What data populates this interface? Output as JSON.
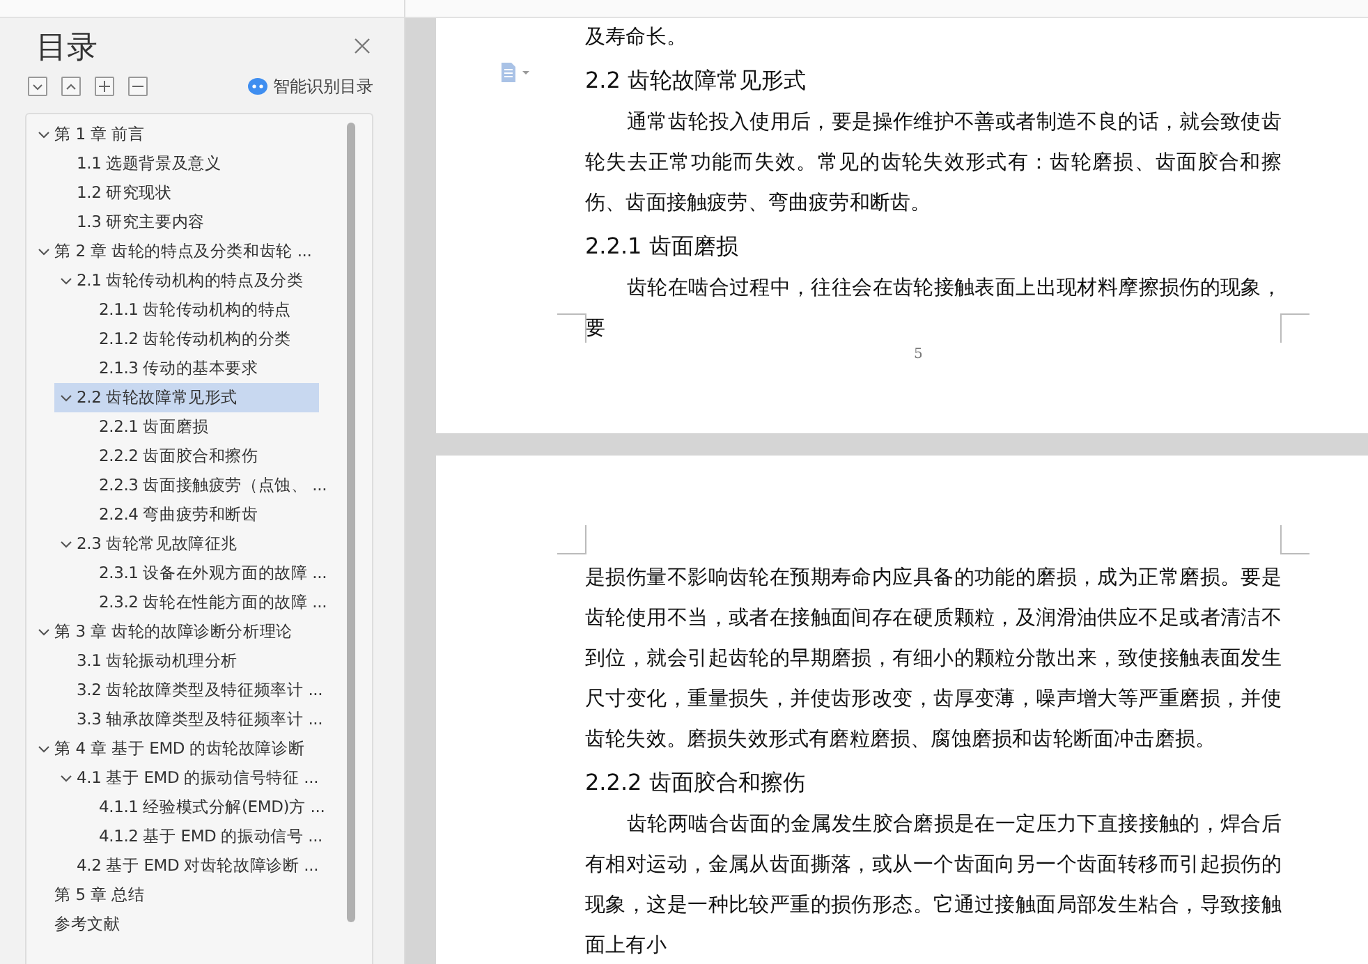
{
  "toc_panel": {
    "title": "目录",
    "smart_button": "智能识别目录",
    "items": [
      {
        "label": "第 1 章  前言",
        "selected": false,
        "expanded": true,
        "children": [
          {
            "label": "1.1 选题背景及意义",
            "selected": false
          },
          {
            "label": "1.2 研究现状",
            "selected": false
          },
          {
            "label": "1.3 研究主要内容",
            "selected": false
          }
        ]
      },
      {
        "label": "第 2 章  齿轮的特点及分类和齿轮 ...",
        "selected": false,
        "expanded": true,
        "children": [
          {
            "label": "2.1 齿轮传动机构的特点及分类",
            "selected": false,
            "expanded": true,
            "children": [
              {
                "label": "2.1.1 齿轮传动机构的特点",
                "selected": false
              },
              {
                "label": "2.1.2 齿轮传动机构的分类",
                "selected": false
              },
              {
                "label": "2.1.3 传动的基本要求",
                "selected": false
              }
            ]
          },
          {
            "label": "2.2 齿轮故障常见形式",
            "selected": true,
            "expanded": true,
            "children": [
              {
                "label": "2.2.1 齿面磨损",
                "selected": false
              },
              {
                "label": "2.2.2 齿面胶合和擦伤",
                "selected": false
              },
              {
                "label": "2.2.3 齿面接触疲劳（点蚀、 ...",
                "selected": false
              },
              {
                "label": "2.2.4 弯曲疲劳和断齿",
                "selected": false
              }
            ]
          },
          {
            "label": "2.3 齿轮常见故障征兆",
            "selected": false,
            "expanded": true,
            "children": [
              {
                "label": "2.3.1 设备在外观方面的故障 ...",
                "selected": false
              },
              {
                "label": "2.3.2 齿轮在性能方面的故障 ...",
                "selected": false
              }
            ]
          }
        ]
      },
      {
        "label": "第 3 章  齿轮的故障诊断分析理论",
        "selected": false,
        "expanded": true,
        "children": [
          {
            "label": "3.1 齿轮振动机理分析",
            "selected": false
          },
          {
            "label": "3.2 齿轮故障类型及特征频率计 ...",
            "selected": false
          },
          {
            "label": "3.3 轴承故障类型及特征频率计 ...",
            "selected": false
          }
        ]
      },
      {
        "label": "第 4 章  基于 EMD 的齿轮故障诊断",
        "selected": false,
        "expanded": true,
        "children": [
          {
            "label": "4.1 基于 EMD 的振动信号特征 ...",
            "selected": false,
            "expanded": true,
            "children": [
              {
                "label": "4.1.1 经验模式分解(EMD)方 ...",
                "selected": false
              },
              {
                "label": "4.1.2 基于 EMD 的振动信号 ...",
                "selected": false
              }
            ]
          },
          {
            "label": "4.2 基于 EMD 对齿轮故障诊断 ...",
            "selected": false
          }
        ]
      },
      {
        "label": "第 5 章  总结",
        "selected": false
      },
      {
        "label": "参考文献",
        "selected": false
      }
    ]
  },
  "pages": [
    {
      "page_number": "5",
      "blocks": [
        {
          "kind": "body",
          "text": "及寿命长。"
        },
        {
          "kind": "heading",
          "text": "2.2 齿轮故障常见形式"
        },
        {
          "kind": "paragraph",
          "text": "通常齿轮投入使用后，要是操作维护不善或者制造不良的话，就会致使齿轮失去正常功能而失效。常见的齿轮失效形式有：齿轮磨损、齿面胶合和擦伤、齿面接触疲劳、弯曲疲劳和断齿。"
        },
        {
          "kind": "heading",
          "text": "2.2.1 齿面磨损"
        },
        {
          "kind": "paragraph",
          "text": "齿轮在啮合过程中，往往会在齿轮接触表面上出现材料摩擦损伤的现象，要"
        }
      ]
    },
    {
      "blocks": [
        {
          "kind": "body",
          "text": "是损伤量不影响齿轮在预期寿命内应具备的功能的磨损，成为正常磨损。要是齿轮使用不当，或者在接触面间存在硬质颗粒，及润滑油供应不足或者清洁不到位，就会引起齿轮的早期磨损，有细小的颗粒分散出来，致使接触表面发生尺寸变化，重量损失，并使齿形改变，齿厚变薄，噪声增大等严重磨损，并使齿轮失效。磨损失效形式有磨粒磨损、腐蚀磨损和齿轮断面冲击磨损。"
        },
        {
          "kind": "heading",
          "text": "2.2.2 齿面胶合和擦伤"
        },
        {
          "kind": "paragraph",
          "text": "齿轮两啮合齿面的金属发生胶合磨损是在一定压力下直接接触的，焊合后有相对运动，金属从齿面撕落，或从一个齿面向另一个齿面转移而引起损伤的现象，这是一种比较严重的损伤形态。它通过接触面局部发生粘合，导致接触面上有小"
        }
      ]
    }
  ]
}
